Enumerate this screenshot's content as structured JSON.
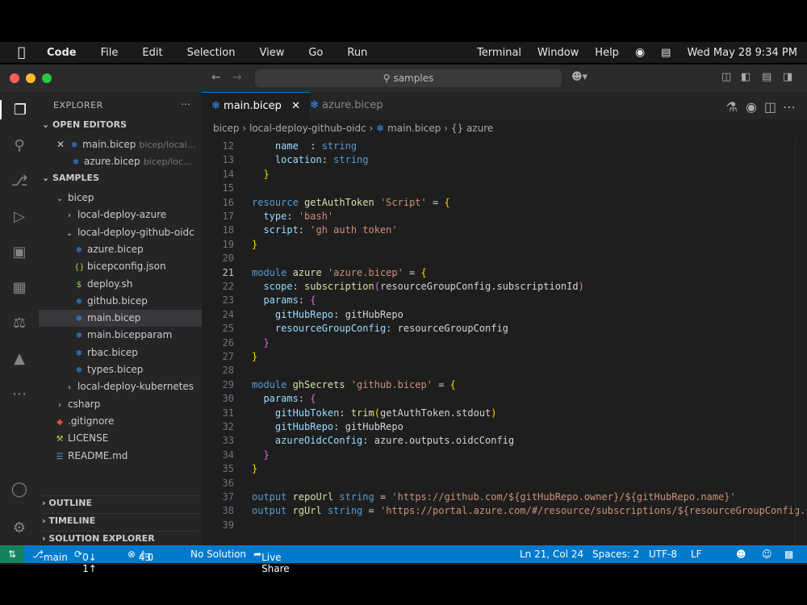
{
  "menubar": {
    "items": [
      "Code",
      "File",
      "Edit",
      "Selection",
      "View",
      "Go",
      "Run",
      "Terminal",
      "Window",
      "Help"
    ],
    "clock": "Wed May 28  9:34 PM"
  },
  "window": {
    "search": "samples"
  },
  "explorer": {
    "title": "EXPLORER",
    "open_editors_label": "OPEN EDITORS",
    "open_editors": [
      {
        "name": "main.bicep",
        "desc": "bicep/local...",
        "modified": true
      },
      {
        "name": "azure.bicep",
        "desc": "bicep/loc..."
      }
    ],
    "samples_label": "SAMPLES",
    "tree": [
      {
        "label": "bicep",
        "indent": 1,
        "kind": "folder-open"
      },
      {
        "label": "local-deploy-azure",
        "indent": 2,
        "kind": "folder"
      },
      {
        "label": "local-deploy-github-oidc",
        "indent": 2,
        "kind": "folder-open"
      },
      {
        "label": "azure.bicep",
        "indent": 3,
        "kind": "bicep"
      },
      {
        "label": "bicepconfig.json",
        "indent": 3,
        "kind": "json"
      },
      {
        "label": "deploy.sh",
        "indent": 3,
        "kind": "sh"
      },
      {
        "label": "github.bicep",
        "indent": 3,
        "kind": "bicep"
      },
      {
        "label": "main.bicep",
        "indent": 3,
        "kind": "bicep",
        "selected": true
      },
      {
        "label": "main.bicepparam",
        "indent": 3,
        "kind": "bicep"
      },
      {
        "label": "rbac.bicep",
        "indent": 3,
        "kind": "bicep"
      },
      {
        "label": "types.bicep",
        "indent": 3,
        "kind": "bicep"
      },
      {
        "label": "local-deploy-kubernetes",
        "indent": 2,
        "kind": "folder"
      },
      {
        "label": "csharp",
        "indent": 1,
        "kind": "folder"
      },
      {
        "label": ".gitignore",
        "indent": 1,
        "kind": "git"
      },
      {
        "label": "LICENSE",
        "indent": 1,
        "kind": "license"
      },
      {
        "label": "README.md",
        "indent": 1,
        "kind": "md"
      }
    ],
    "outline_label": "OUTLINE",
    "timeline_label": "TIMELINE",
    "solution_label": "SOLUTION EXPLORER"
  },
  "tabs": [
    {
      "label": "main.bicep",
      "active": true
    },
    {
      "label": "azure.bicep",
      "active": false
    }
  ],
  "breadcrumb": [
    "bicep",
    "local-deploy-github-oidc",
    "main.bicep",
    "{} azure"
  ],
  "code": {
    "current_line": 21,
    "lines": [
      {
        "n": "12",
        "segs": [
          [
            "prop",
            "    name"
          ],
          [
            "",
            "  : "
          ],
          [
            "kw",
            "string"
          ]
        ]
      },
      {
        "n": "13",
        "segs": [
          [
            "prop",
            "    location"
          ],
          [
            "",
            ": "
          ],
          [
            "kw",
            "string"
          ]
        ]
      },
      {
        "n": "14",
        "segs": [
          [
            "br",
            "  }"
          ]
        ]
      },
      {
        "n": "15",
        "segs": []
      },
      {
        "n": "16",
        "segs": [
          [
            "kw",
            "resource "
          ],
          [
            "id",
            "getAuthToken "
          ],
          [
            "str",
            "'Script'"
          ],
          [
            "",
            " = "
          ],
          [
            "br",
            "{"
          ]
        ]
      },
      {
        "n": "17",
        "segs": [
          [
            "prop",
            "  type"
          ],
          [
            "",
            ": "
          ],
          [
            "str",
            "'bash'"
          ]
        ]
      },
      {
        "n": "18",
        "segs": [
          [
            "prop",
            "  script"
          ],
          [
            "",
            ": "
          ],
          [
            "str",
            "'gh auth token'"
          ]
        ]
      },
      {
        "n": "19",
        "segs": [
          [
            "br",
            "}"
          ]
        ]
      },
      {
        "n": "20",
        "segs": []
      },
      {
        "n": "21",
        "segs": [
          [
            "kw",
            "module "
          ],
          [
            "id",
            "azure "
          ],
          [
            "str",
            "'azure.bicep'"
          ],
          [
            "",
            " = "
          ],
          [
            "br",
            "{"
          ]
        ]
      },
      {
        "n": "22",
        "segs": [
          [
            "prop",
            "  scope"
          ],
          [
            "",
            ": "
          ],
          [
            "fn",
            "subscription"
          ],
          [
            "br2",
            "("
          ],
          [
            "",
            "resourceGroupConfig.subscriptionId"
          ],
          [
            "br2",
            ")"
          ]
        ]
      },
      {
        "n": "23",
        "segs": [
          [
            "prop",
            "  params"
          ],
          [
            "",
            ": "
          ],
          [
            "br2",
            "{"
          ]
        ]
      },
      {
        "n": "24",
        "segs": [
          [
            "prop",
            "    gitHubRepo"
          ],
          [
            "",
            ": gitHubRepo"
          ]
        ]
      },
      {
        "n": "25",
        "segs": [
          [
            "prop",
            "    resourceGroupConfig"
          ],
          [
            "",
            ": resourceGroupConfig"
          ]
        ]
      },
      {
        "n": "26",
        "segs": [
          [
            "br2",
            "  }"
          ]
        ]
      },
      {
        "n": "27",
        "segs": [
          [
            "br",
            "}"
          ]
        ]
      },
      {
        "n": "28",
        "segs": []
      },
      {
        "n": "29",
        "segs": [
          [
            "kw",
            "module "
          ],
          [
            "id",
            "ghSecrets "
          ],
          [
            "str",
            "'github.bicep'"
          ],
          [
            "",
            " = "
          ],
          [
            "br",
            "{"
          ]
        ]
      },
      {
        "n": "30",
        "segs": [
          [
            "prop",
            "  params"
          ],
          [
            "",
            ": "
          ],
          [
            "br2",
            "{"
          ]
        ]
      },
      {
        "n": "31",
        "segs": [
          [
            "prop",
            "    gitHubToken"
          ],
          [
            "",
            ": "
          ],
          [
            "fn",
            "trim"
          ],
          [
            "br",
            "("
          ],
          [
            "",
            "getAuthToken.stdout"
          ],
          [
            "br",
            ")"
          ]
        ]
      },
      {
        "n": "32",
        "segs": [
          [
            "prop",
            "    gitHubRepo"
          ],
          [
            "",
            ": gitHubRepo"
          ]
        ]
      },
      {
        "n": "33",
        "segs": [
          [
            "prop",
            "    azureOidcConfig"
          ],
          [
            "",
            ": azure.outputs.oidcConfig"
          ]
        ]
      },
      {
        "n": "34",
        "segs": [
          [
            "br2",
            "  }"
          ]
        ]
      },
      {
        "n": "35",
        "segs": [
          [
            "br",
            "}"
          ]
        ]
      },
      {
        "n": "36",
        "segs": []
      },
      {
        "n": "37",
        "segs": [
          [
            "kw",
            "output "
          ],
          [
            "id",
            "repoUrl "
          ],
          [
            "kw",
            "string"
          ],
          [
            "",
            " = "
          ],
          [
            "str",
            "'https://github.com/${gitHubRepo.owner}/${gitHubRepo.name}'"
          ]
        ]
      },
      {
        "n": "38",
        "segs": [
          [
            "kw",
            "output "
          ],
          [
            "id",
            "rgUrl "
          ],
          [
            "kw",
            "string"
          ],
          [
            "",
            " = "
          ],
          [
            "str",
            "'https://portal.azure.com/#/resource/subscriptions/${resourceGroupConfig.su"
          ]
        ]
      },
      {
        "n": "39",
        "segs": []
      }
    ]
  },
  "status": {
    "branch": "main",
    "sync": "0↓ 1↑",
    "problems_errors": "43",
    "problems_warnings": "0",
    "solution": "No Solution",
    "live_share": "Live Share",
    "position": "Ln 21, Col 24",
    "spaces": "Spaces: 2",
    "encoding": "UTF-8",
    "eol": "LF"
  },
  "colors": {
    "accent": "#007acc",
    "tab_border": "#0078d4"
  }
}
